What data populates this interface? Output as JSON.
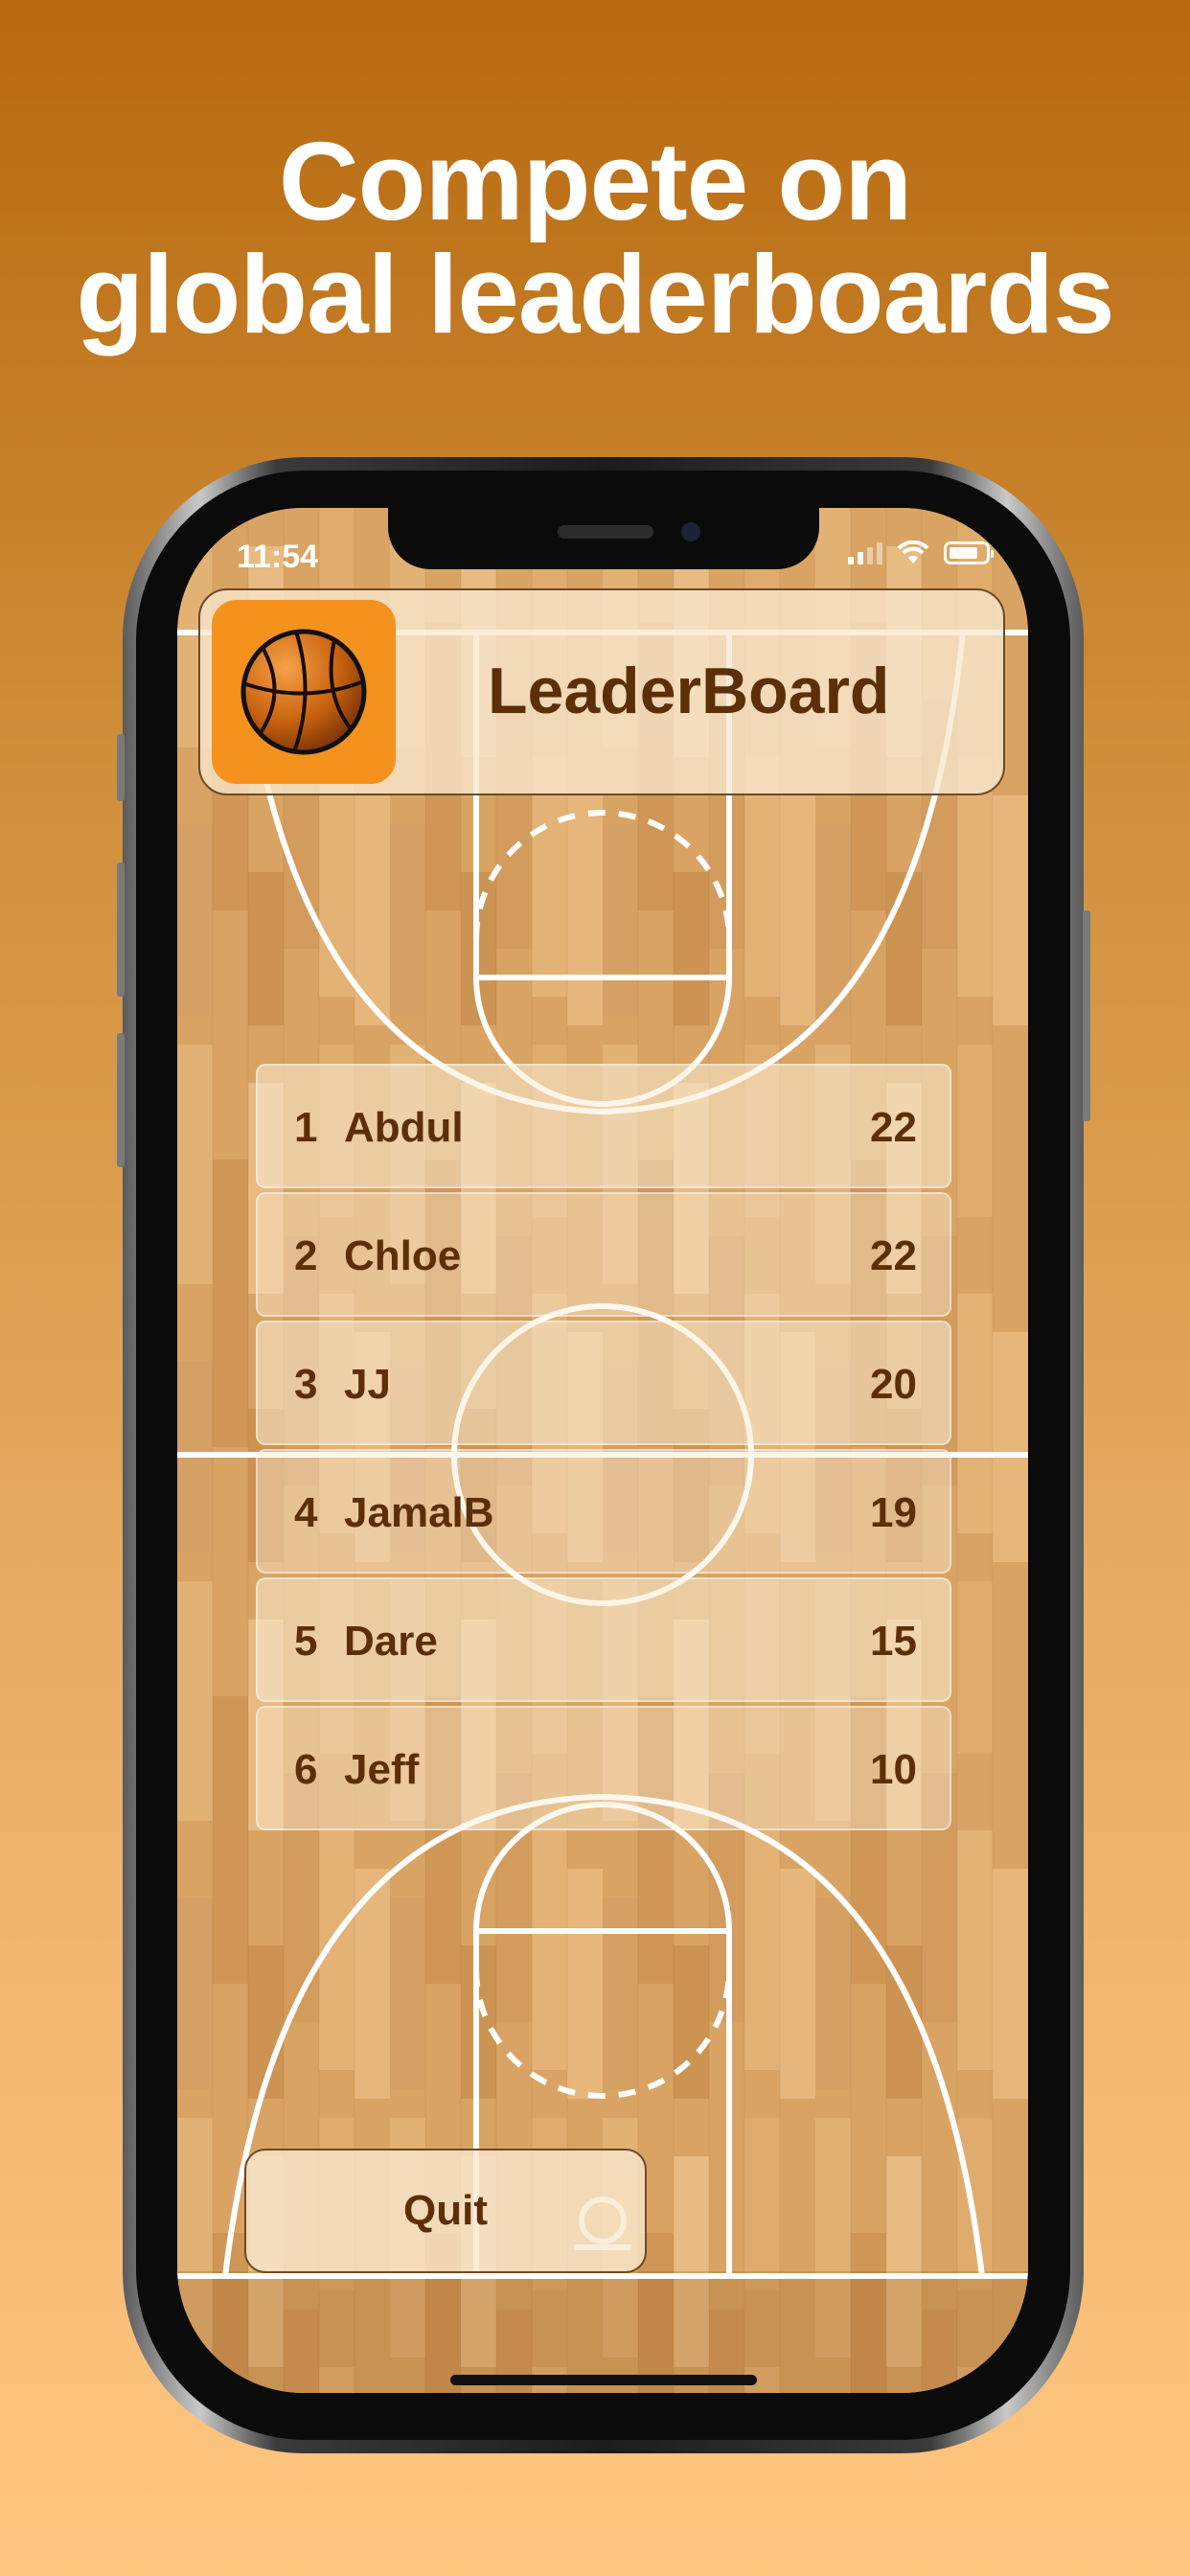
{
  "headline": {
    "line1": "Compete on",
    "line2": "global leaderboards"
  },
  "status_bar": {
    "time": "11:54"
  },
  "header": {
    "title": "LeaderBoard"
  },
  "leaderboard": [
    {
      "rank": "1",
      "name": "Abdul",
      "score": "22"
    },
    {
      "rank": "2",
      "name": "Chloe",
      "score": "22"
    },
    {
      "rank": "3",
      "name": "JJ",
      "score": "20"
    },
    {
      "rank": "4",
      "name": "JamalB",
      "score": "19"
    },
    {
      "rank": "5",
      "name": "Dare",
      "score": "15"
    },
    {
      "rank": "6",
      "name": "Jeff",
      "score": "10"
    }
  ],
  "quit_label": "Quit",
  "icons": {
    "logo": "basketball-icon",
    "signal": "cellular-signal-icon",
    "wifi": "wifi-icon",
    "battery": "battery-icon"
  },
  "colors": {
    "text_brown": "#5c2f08",
    "logo_orange": "#f5921e",
    "court_wood": "#d9a463"
  }
}
